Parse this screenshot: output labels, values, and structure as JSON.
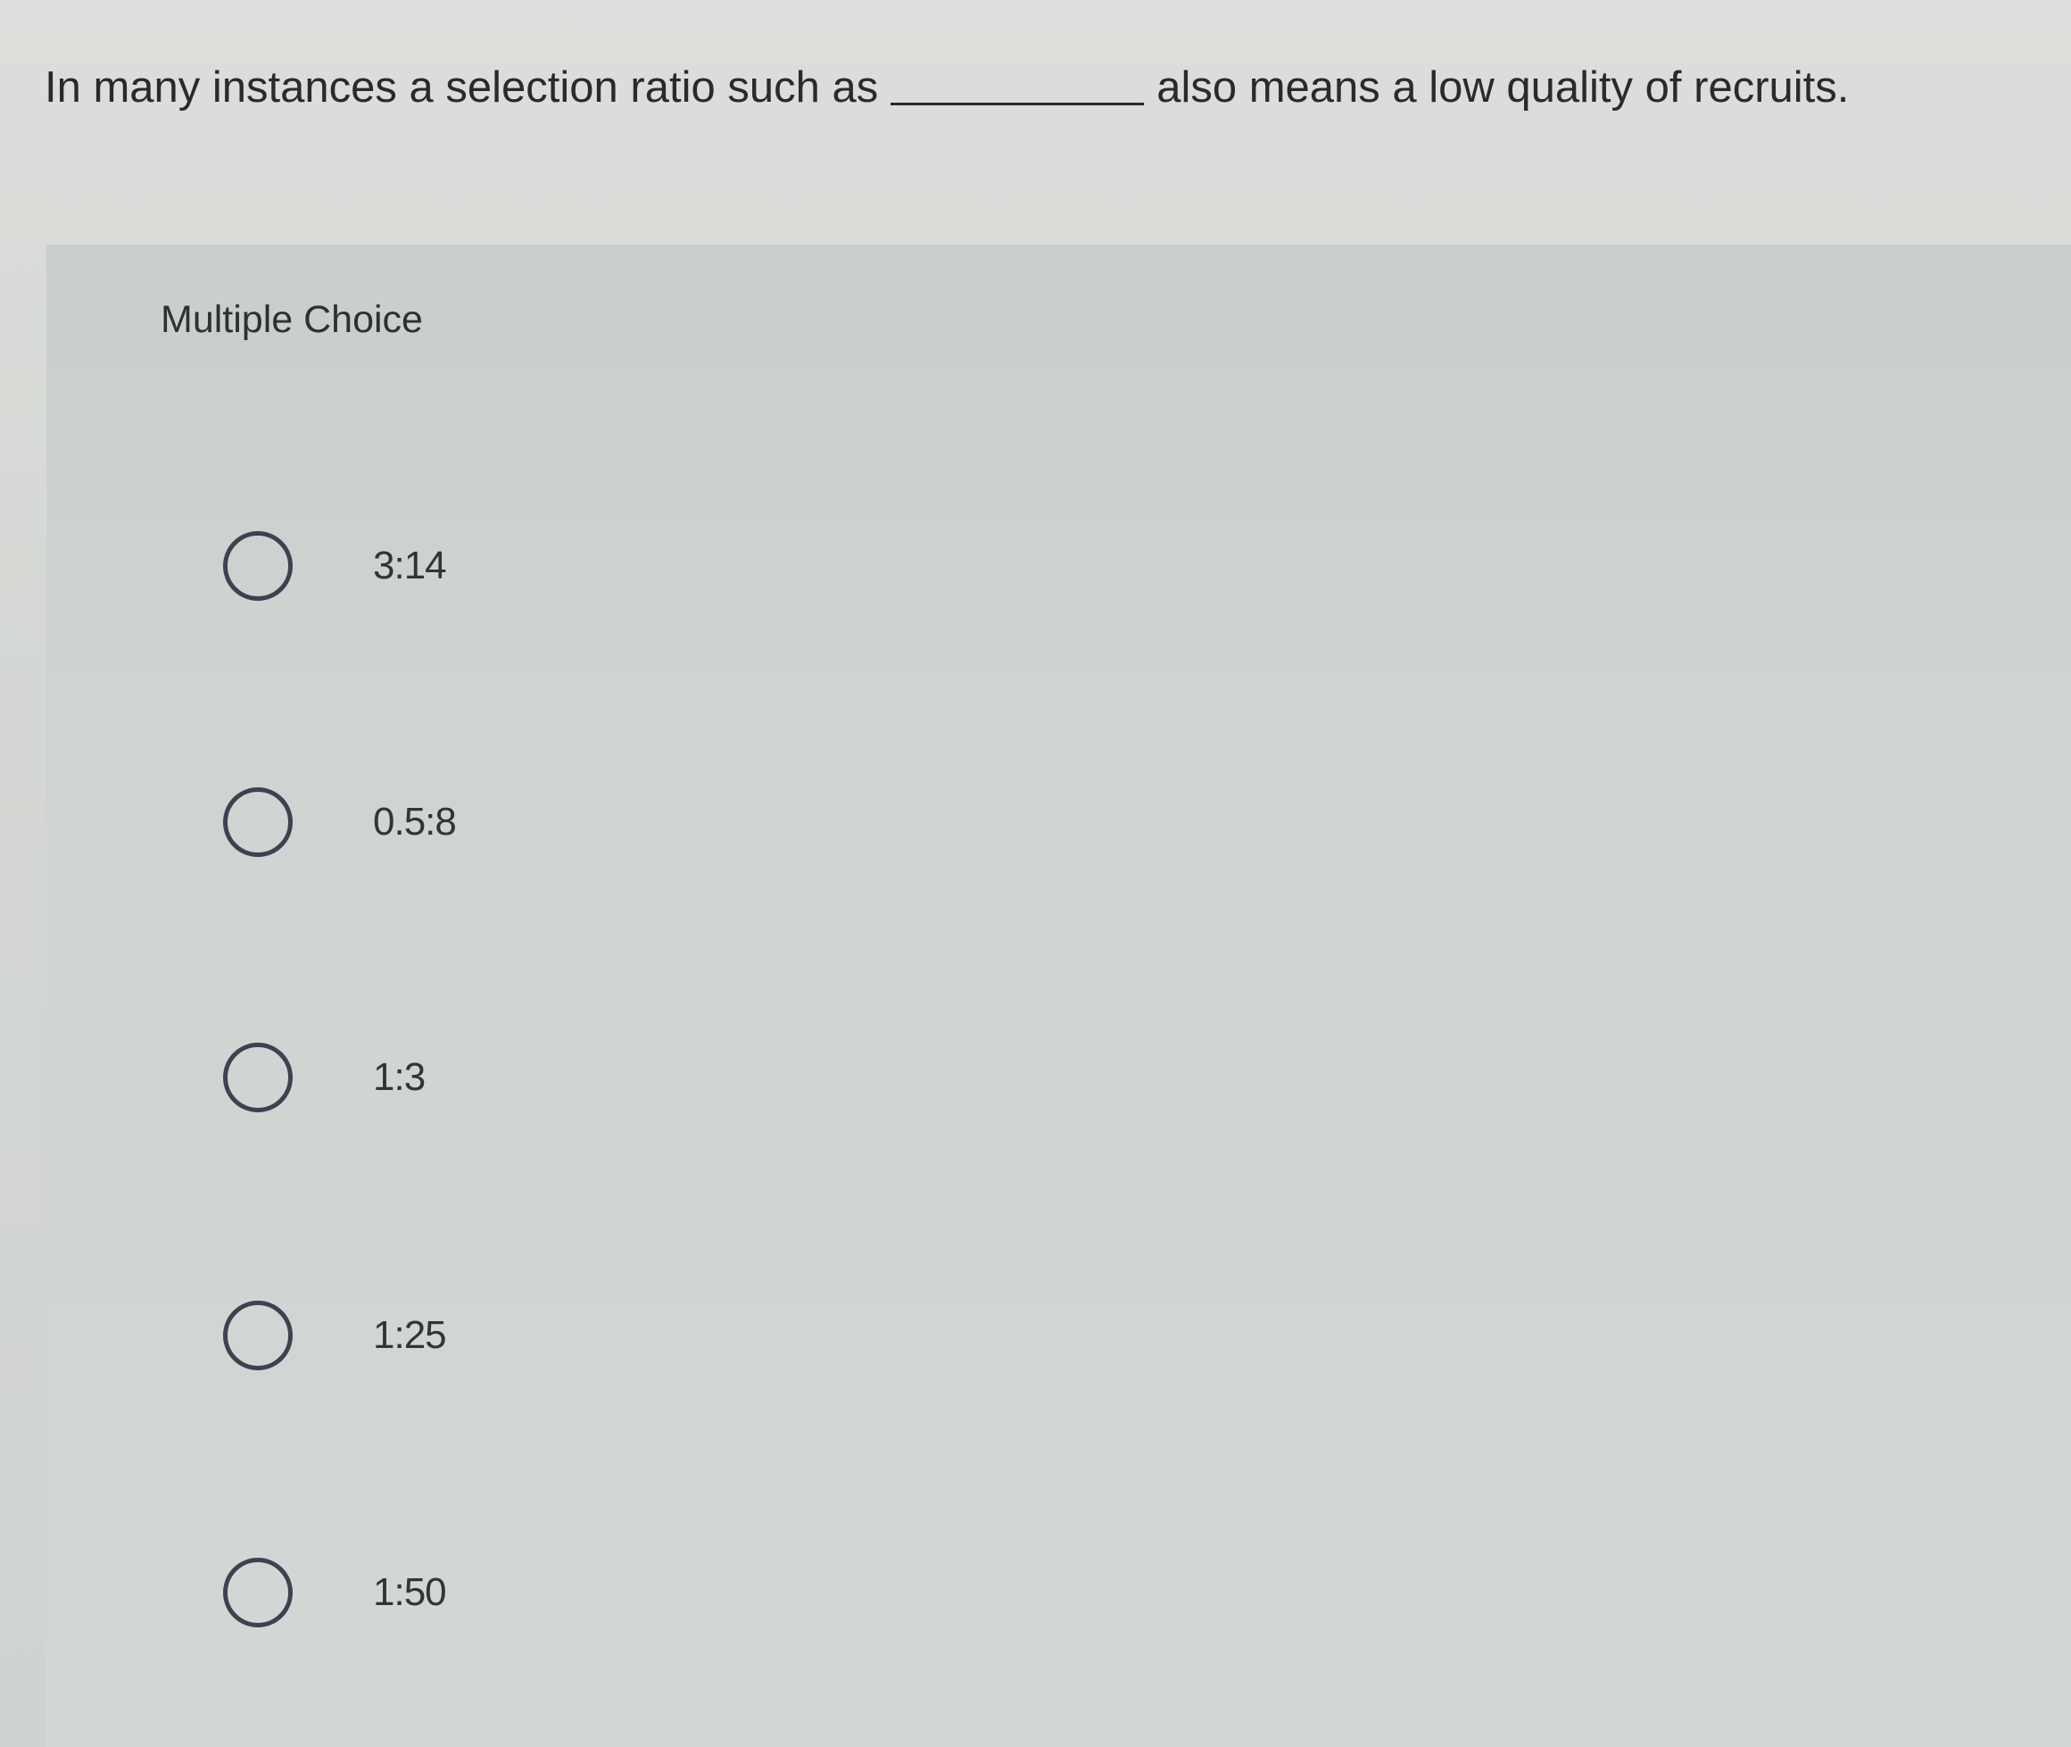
{
  "question": {
    "before_blank": "In many instances a selection ratio such as",
    "after_blank": "also means a low quality of recruits."
  },
  "card": {
    "type_label": "Multiple Choice",
    "options": [
      {
        "label": "3:14"
      },
      {
        "label": "0.5:8"
      },
      {
        "label": "1:3"
      },
      {
        "label": "1:25"
      },
      {
        "label": "1:50"
      }
    ]
  },
  "colors": {
    "background": "#d3d6d2",
    "card": "#cbcfce",
    "text": "#2a2a2c",
    "radio_border": "#3c4250"
  }
}
